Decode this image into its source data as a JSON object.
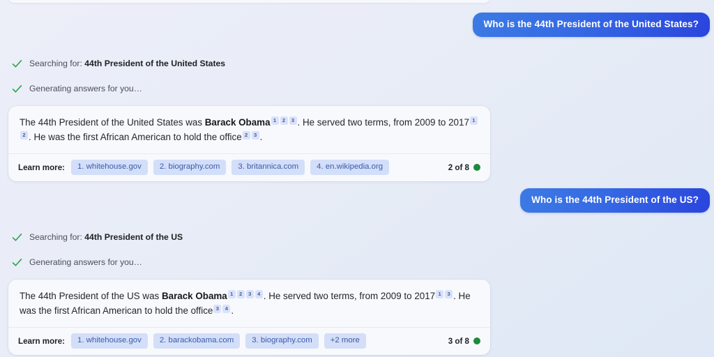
{
  "background": {
    "gradient_start": "#eceef8",
    "gradient_end": "#dfe8f6"
  },
  "theme": {
    "user_bubble_from": "#3c7ae4",
    "user_bubble_to": "#2a45dd",
    "citation_bg": "#d9e2fb",
    "chip_bg": "#d3def9",
    "chip_text": "#3a5ca8",
    "check_green": "#2aa44a",
    "status_dot_green": "#1d8a3c",
    "card_bg": "#f8f9fc"
  },
  "turns": [
    {
      "user_message": "Who is the 44th President of the United States?",
      "status_rows": [
        {
          "icon": "check-icon",
          "prefix": "Searching for: ",
          "query": "44th President of the United States"
        },
        {
          "icon": "check-icon",
          "prefix": "Generating answers for you…",
          "query": ""
        }
      ],
      "answer": {
        "segments": [
          {
            "type": "text",
            "text": "The 44th President of the United States was "
          },
          {
            "type": "bold",
            "text": "Barack Obama"
          },
          {
            "type": "cite",
            "text": "1"
          },
          {
            "type": "cite",
            "text": "2"
          },
          {
            "type": "cite",
            "text": "3"
          },
          {
            "type": "text",
            "text": ". He served two terms, from 2009 to 2017"
          },
          {
            "type": "cite",
            "text": "1"
          },
          {
            "type": "cite",
            "text": "2"
          },
          {
            "type": "text",
            "text": ". He was the first African American to hold the office"
          },
          {
            "type": "cite",
            "text": "2"
          },
          {
            "type": "cite",
            "text": "3"
          },
          {
            "type": "text",
            "text": "."
          }
        ],
        "plain_text": "The 44th President of the United States was Barack Obama 1 2 3 . He served two terms, from 2009 to 2017 1 2 . He was the first African American to hold the office 2 3 .",
        "learn_more_label": "Learn more:",
        "sources": [
          "1. whitehouse.gov",
          "2. biography.com",
          "3. britannica.com",
          "4. en.wikipedia.org"
        ],
        "count_text": "2 of 8",
        "status_dot": "green"
      }
    },
    {
      "user_message": "Who is the 44th President of the US?",
      "status_rows": [
        {
          "icon": "check-icon",
          "prefix": "Searching for: ",
          "query": "44th President of the US"
        },
        {
          "icon": "check-icon",
          "prefix": "Generating answers for you…",
          "query": ""
        }
      ],
      "answer": {
        "segments": [
          {
            "type": "text",
            "text": "The 44th President of the US was "
          },
          {
            "type": "bold",
            "text": "Barack Obama"
          },
          {
            "type": "cite",
            "text": "1"
          },
          {
            "type": "cite",
            "text": "2"
          },
          {
            "type": "cite",
            "text": "3"
          },
          {
            "type": "cite",
            "text": "4"
          },
          {
            "type": "text",
            "text": ". He served two terms, from 2009 to 2017"
          },
          {
            "type": "cite",
            "text": "1"
          },
          {
            "type": "cite",
            "text": "3"
          },
          {
            "type": "text",
            "text": ". He was the first African American to hold the office"
          },
          {
            "type": "cite",
            "text": "3"
          },
          {
            "type": "cite",
            "text": "4"
          },
          {
            "type": "text",
            "text": "."
          }
        ],
        "plain_text": "The 44th President of the US was Barack Obama 1 2 3 4 . He served two terms, from 2009 to 2017 1 3 . He was the first African American to hold the office 3 4 .",
        "learn_more_label": "Learn more:",
        "sources": [
          "1. whitehouse.gov",
          "2. barackobama.com",
          "3. biography.com",
          "+2 more"
        ],
        "count_text": "3 of 8",
        "status_dot": "green"
      }
    }
  ]
}
